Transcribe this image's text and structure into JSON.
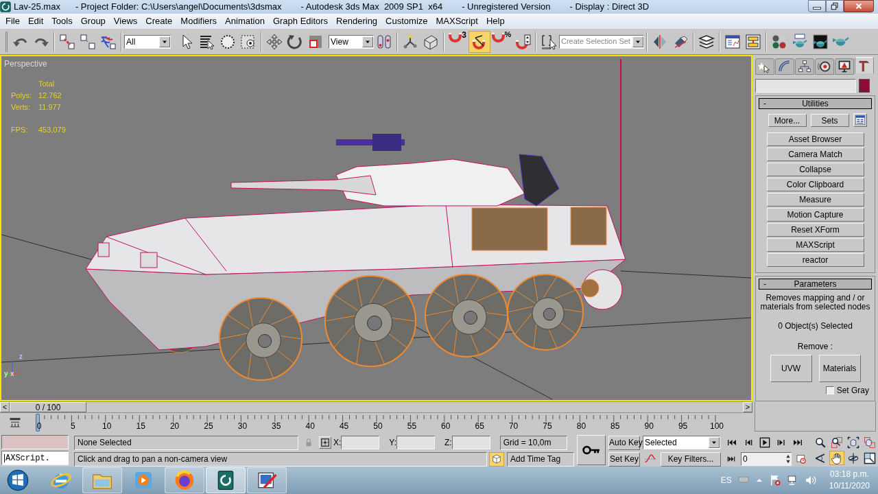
{
  "title_bar": {
    "segments": [
      "Lav-25.max",
      "- Project Folder: C:\\Users\\angel\\Documents\\3dsmax",
      "- Autodesk 3ds Max  2009 SP1  x64",
      "- Unregistered Version",
      "- Display : Direct 3D"
    ]
  },
  "menu_bar": [
    "File",
    "Edit",
    "Tools",
    "Group",
    "Views",
    "Create",
    "Modifiers",
    "Animation",
    "Graph Editors",
    "Rendering",
    "Customize",
    "MAXScript",
    "Help"
  ],
  "toolbar": {
    "selection_filter": "All",
    "reference_coordinate_system": "View",
    "snap_mark": "3",
    "angle_snap_on": true,
    "percent_snap_mark": "%",
    "named_selection_set": {
      "placeholder": "Create Selection Set"
    }
  },
  "viewport": {
    "label": "Perspective",
    "active": true,
    "stats_header": "Total",
    "stats": [
      {
        "label": "Polys:",
        "value": "12.762"
      },
      {
        "label": "Verts:",
        "value": "11.977"
      }
    ],
    "fps": {
      "label": "FPS:",
      "value": "453,079"
    },
    "axis_labels": [
      "z",
      "y",
      "x"
    ]
  },
  "command_panel": {
    "tabs": [
      {
        "selected": false
      },
      {
        "selected": false
      },
      {
        "selected": false
      },
      {
        "selected": false
      },
      {
        "selected": false
      },
      {
        "selected": true
      }
    ],
    "utilities": {
      "collapse_mark": "-",
      "title": "Utilities",
      "more_button": "More...",
      "sets_button": "Sets",
      "buttons": [
        "Asset Browser",
        "Camera Match",
        "Collapse",
        "Color Clipboard",
        "Measure",
        "Motion Capture",
        "Reset XForm",
        "MAXScript",
        "reactor"
      ]
    },
    "parameters": {
      "collapse_mark": "-",
      "title": "Parameters",
      "description": "Removes mapping and / or materials from selected nodes",
      "selection_count": "0 Object(s) Selected",
      "remove_label": "Remove :",
      "remove_buttons": [
        "UVW",
        "Materials"
      ],
      "set_gray": {
        "label": "Set Gray",
        "checked": false
      }
    }
  },
  "time_slider": {
    "prev": "<",
    "label": "0 / 100",
    "next": ">",
    "level": 0
  },
  "timeline": {
    "ticks": [
      "0",
      "5",
      "10",
      "15",
      "20",
      "25",
      "30",
      "35",
      "40",
      "45",
      "50",
      "55",
      "60",
      "65",
      "70",
      "75",
      "80",
      "85",
      "90",
      "95",
      "100"
    ]
  },
  "status": {
    "listener_input": "AXScript.",
    "selection": "None Selected",
    "prompt": "Click and drag to pan a non-camera view",
    "coords": [
      {
        "label": "X:"
      },
      {
        "label": "Y:"
      },
      {
        "label": "Z:"
      }
    ],
    "grid": "Grid = 10,0m",
    "time_tag": {
      "label": "Add Time Tag",
      "active": true
    }
  },
  "animation": {
    "auto_key": "Auto Key",
    "key_set": "Selected",
    "set_key": "Set Key",
    "key_filters": "Key Filters...",
    "current_frame": "0"
  },
  "viewport_nav": {
    "pan_active": true
  },
  "taskbar": {
    "apps": [
      {
        "running": false,
        "selected": false
      },
      {
        "running": true,
        "selected": false
      },
      {
        "running": false,
        "selected": false
      },
      {
        "running": true,
        "selected": false
      },
      {
        "running": true,
        "selected": true
      },
      {
        "running": true,
        "selected": false
      }
    ],
    "language": "ES",
    "time": "03:18 p.m.",
    "date": "10/11/2020"
  }
}
